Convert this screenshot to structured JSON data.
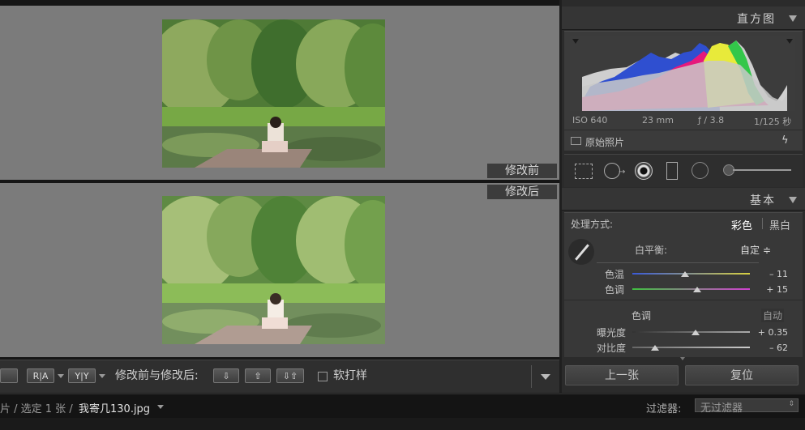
{
  "view": {
    "before_label": "修改前",
    "after_label": "修改后"
  },
  "toolbar": {
    "view_mode_loupe": "",
    "view_mode_ra": "R|A",
    "view_mode_yy": "Y|Y",
    "compare_label": "修改前与修改后:",
    "soft_proof_label": "软打样"
  },
  "filmstrip": {
    "path_prefix": "片 / 选定 1 张 /",
    "filename": "我寄几130.jpg",
    "filter_label": "过滤器:",
    "filter_value": "无过滤器"
  },
  "histogram": {
    "title": "直方图",
    "iso": "ISO 640",
    "focal": "23 mm",
    "aperture": "ƒ / 3.8",
    "shutter": "1/125 秒",
    "original_photo": "原始照片"
  },
  "basic": {
    "title": "基本",
    "treatment_label": "处理方式:",
    "treatment_color": "彩色",
    "treatment_bw": "黑白",
    "wb_label": "白平衡:",
    "wb_value": "自定 ≑",
    "temp_label": "色温",
    "temp_value": "– 11",
    "temp_level": -11,
    "tint_label": "色调",
    "tint_value": "+ 15",
    "tint_level": 15,
    "tone_label": "色调",
    "auto_label": "自动",
    "exposure_label": "曝光度",
    "exposure_value": "+ 0.35",
    "exposure_level": 0.35,
    "contrast_label": "对比度",
    "contrast_value": "– 62",
    "contrast_level": -62
  },
  "buttons": {
    "previous": "上一张",
    "reset": "复位"
  },
  "colors": {
    "panel_bg": "#2b2b2b",
    "viewer_bg": "#7b7b7b",
    "accent_magenta": "#e6197c"
  }
}
